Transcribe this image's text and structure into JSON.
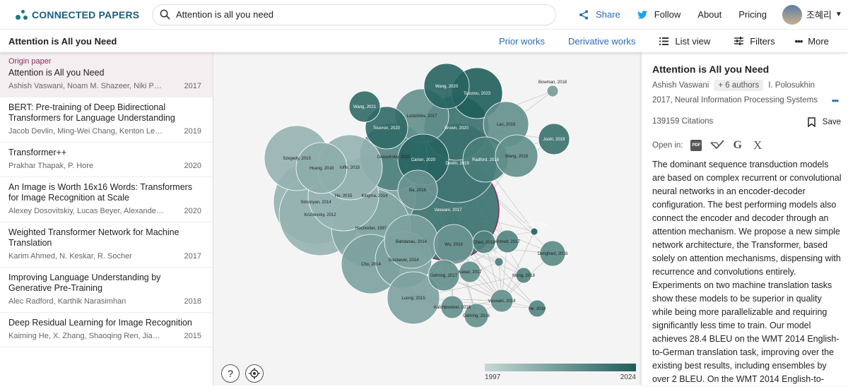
{
  "brand": {
    "name": "CONNECTED PAPERS"
  },
  "search": {
    "value": "Attention is all you need"
  },
  "topnav": {
    "share": "Share",
    "follow": "Follow",
    "about": "About",
    "pricing": "Pricing",
    "user": "조혜리"
  },
  "subbar": {
    "title": "Attention is All you Need",
    "prior": "Prior works",
    "derivative": "Derivative works",
    "list_view": "List view",
    "filters": "Filters",
    "more": "More"
  },
  "papers": [
    {
      "label": "Origin paper",
      "title": "Attention is All you Need",
      "authors": "Ashish Vaswani, Noam M. Shazeer, Niki Parmar,...",
      "year": "2017"
    },
    {
      "title": "BERT: Pre-training of Deep Bidirectional Transformers for Language Understanding",
      "authors": "Jacob Devlin, Ming-Wei Chang, Kenton Lee,...",
      "year": "2019"
    },
    {
      "title": "Transformer++",
      "authors": "Prakhar Thapak, P. Hore",
      "year": "2020"
    },
    {
      "title": "An Image is Worth 16x16 Words: Transformers for Image Recognition at Scale",
      "authors": "Alexey Dosovitskiy, Lucas Beyer, Alexander...",
      "year": "2020"
    },
    {
      "title": "Weighted Transformer Network for Machine Translation",
      "authors": "Karim Ahmed, N. Keskar, R. Socher",
      "year": "2017"
    },
    {
      "title": "Improving Language Understanding by Generative Pre-Training",
      "authors": "Alec Radford, Karthik Narasimhan",
      "year": "2018"
    },
    {
      "title": "Deep Residual Learning for Image Recognition",
      "authors": "Kaiming He, X. Zhang, Shaoqing Ren, Jian Sun",
      "year": "2015"
    }
  ],
  "graph": {
    "legend": {
      "min": "1997",
      "max": "2024"
    },
    "help": "?",
    "nodes": [
      "Bowman, 2018",
      "Wang, 2020",
      "Tsourou, 2023",
      "Wang, 2021",
      "Lostchilov, 2017",
      "Touvron, 2020",
      "Brown, 2020",
      "Lan, 2019",
      "Joshi, 2019",
      "Carion, 2020",
      "Radford, 2018",
      "Wang, 2018",
      "Szegedy, 2015",
      "Huang, 2018",
      "Ioffe, 2015",
      "Dosovitskiy, 2020",
      "Devlin, 2019",
      "Ba, 2016",
      "Simonyan, 2014",
      "He, 2015",
      "Kingma, 2014",
      "Krizhevsky, 2012",
      "Vaswani, 2017",
      "Jeevan, 2024",
      "Hochreiter, 1997",
      "Bahdanau, 2014",
      "Wu, 2016",
      "Chen, 2018",
      "Ahmed, 2017",
      "Dehghani, 2018",
      "Sutskever, 2014",
      "Cho, 2014",
      "Thapak, 2020",
      "Kaiser, 2017",
      "Gehring, 2017",
      "Meng, 2018",
      "Luong, 2015",
      "Vaswani, 2018",
      "Kalchbrenner, 2016",
      "He, 2018",
      "Gehring, 2016"
    ]
  },
  "detail": {
    "title": "Attention is All you Need",
    "first_author": "Ashish Vaswani",
    "more_authors": "+ 6 authors",
    "last_author": "I. Polosukhin",
    "venue": "2017, Neural Information Processing Systems",
    "citations": "139159 Citations",
    "save": "Save",
    "open_in": "Open in:",
    "abstract": "The dominant sequence transduction models are based on complex recurrent or convolutional neural networks in an encoder-decoder configuration. The best performing models also connect the encoder and decoder through an attention mechanism. We propose a new simple network architecture, the Transformer, based solely on attention mechanisms, dispensing with recurrence and convolutions entirely. Experiments on two machine translation tasks show these models to be superior in quality while being more parallelizable and requiring significantly less time to train. Our model achieves 28.4 BLEU on the WMT 2014 English-to-German translation task, improving over the existing best results, including ensembles by over 2 BLEU. On the WMT 2014 English-to-"
  },
  "colors": {
    "accent": "#1b5e7e",
    "link": "#2a6db0",
    "node_dark": "#1f5e5a",
    "node_light": "#c8d8d6",
    "origin": "#8a2a5a"
  }
}
